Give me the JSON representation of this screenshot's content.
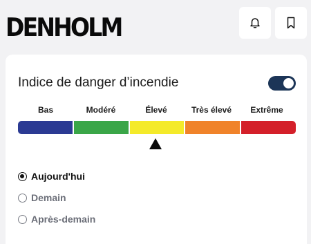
{
  "header": {
    "brand": "DENHOLM",
    "notifications_icon": "bell-icon",
    "bookmark_icon": "bookmark-icon"
  },
  "fire_danger": {
    "title": "Indice de danger d’incendie",
    "toggle_on": true,
    "levels": [
      {
        "label": "Bas",
        "color": "#2b3a93"
      },
      {
        "label": "Modéré",
        "color": "#3aa648"
      },
      {
        "label": "Élevé",
        "color": "#f4ea2a"
      },
      {
        "label": "Très élevé",
        "color": "#f0832a"
      },
      {
        "label": "Extrême",
        "color": "#d4202a"
      }
    ],
    "current_level": "Élevé",
    "days": [
      {
        "label": "Aujourd'hui",
        "selected": true
      },
      {
        "label": "Demain",
        "selected": false
      },
      {
        "label": "Après-demain",
        "selected": false
      }
    ]
  }
}
